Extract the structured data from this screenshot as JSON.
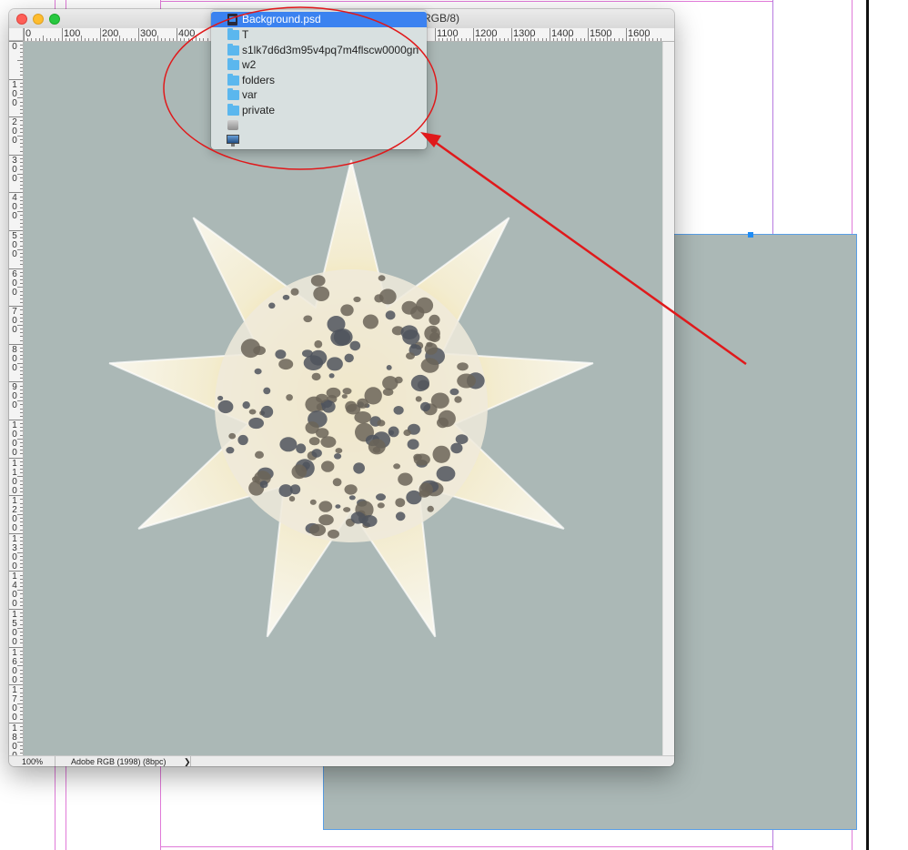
{
  "window": {
    "title_tail": "RGB/8)",
    "zoom": "100%",
    "color_profile": "Adobe RGB (1998) (8bpc)",
    "status_arrow": "❯"
  },
  "ruler": {
    "h_labels": [
      "0",
      "100",
      "200",
      "300",
      "400",
      "1100",
      "1200",
      "1300",
      "1400",
      "1500",
      "1600"
    ],
    "v_labels": [
      "0",
      "100",
      "200",
      "300",
      "400",
      "500",
      "600",
      "700",
      "800",
      "900",
      "1000",
      "1100",
      "1200",
      "1300",
      "1400",
      "1500",
      "1600",
      "1700",
      "1800"
    ]
  },
  "path_menu": {
    "items": [
      {
        "label": "Background.psd",
        "icon": "psd-file-icon",
        "selected": true
      },
      {
        "label": "T",
        "icon": "folder-icon"
      },
      {
        "label": "s1lk7d6d3m95v4pq7m4flscw0000gn",
        "icon": "folder-icon"
      },
      {
        "label": "w2",
        "icon": "folder-icon"
      },
      {
        "label": "folders",
        "icon": "folder-icon"
      },
      {
        "label": "var",
        "icon": "folder-icon"
      },
      {
        "label": "private",
        "icon": "folder-icon"
      },
      {
        "label": "",
        "icon": "hard-disk-icon"
      },
      {
        "label": "",
        "icon": "computer-icon"
      }
    ]
  },
  "colors": {
    "canvas_bg": "#abb8b6",
    "selection": "#3b82f0",
    "annotation": "#e0191b",
    "guides": "#e07ad8"
  }
}
